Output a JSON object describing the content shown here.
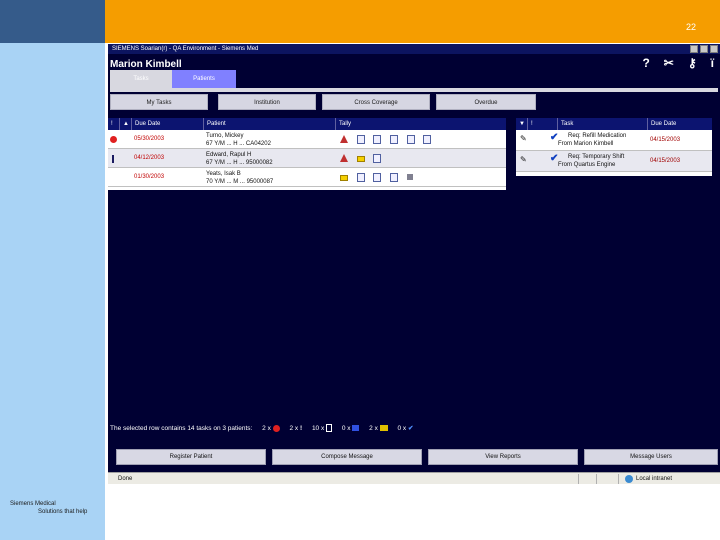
{
  "slide": {
    "number": "22",
    "footer_line1": "Siemens Medical",
    "footer_line2": "Solutions that help"
  },
  "window": {
    "title": "SIEMENS Soarian(r) - QA Environment - Siemens Med",
    "user_name": "Marion Kimbell"
  },
  "header_icons": [
    {
      "name": "help-icon",
      "glyph": "?"
    },
    {
      "name": "tools-icon",
      "glyph": "✂"
    },
    {
      "name": "key-icon",
      "glyph": "⚷"
    },
    {
      "name": "user-icon",
      "glyph": "ï"
    }
  ],
  "main_tabs": [
    {
      "label": "Tasks",
      "active": true
    },
    {
      "label": "Patients",
      "active": false
    }
  ],
  "sub_tabs": [
    {
      "label": "My Tasks"
    },
    {
      "label": "Institution"
    },
    {
      "label": "Cross Coverage"
    },
    {
      "label": "Overdue"
    }
  ],
  "left_table": {
    "headers": {
      "flag": "!",
      "due_date": "Due Date",
      "patient": "Patient",
      "tally": "Tally"
    },
    "rows": [
      {
        "flag": "red",
        "due_date": "05/30/2003",
        "patient_name": "Turno, Mickey",
        "patient_info": "67 Y/M  ...  H  ...  CA04202",
        "tally": [
          "alert",
          "doc",
          "doc",
          "doc",
          "doc",
          "doc",
          "doc"
        ]
      },
      {
        "flag": "bar",
        "due_date": "04/12/2003",
        "patient_name": "Edward, Rapul H",
        "patient_info": "67 Y/M  ...  H  ...  95000082",
        "tally": [
          "alert-doc",
          "env",
          "doc"
        ]
      },
      {
        "flag": "none",
        "due_date": "01/30/2003",
        "patient_name": "Yeats, Isak B",
        "patient_info": "70 Y/M  ...  M  ...  95000087",
        "tally": [
          "env",
          "doc",
          "doc",
          "doc",
          "mini"
        ]
      }
    ]
  },
  "right_table": {
    "headers": {
      "flag": "!",
      "task": "Task",
      "due_date": "Due Date"
    },
    "rows": [
      {
        "line1": "Req: Refill Medication",
        "line2": "From Marion Kimbell",
        "due_date": "04/15/2003"
      },
      {
        "line1": "Req: Temporary Shift",
        "line2": "From Quartus Engine",
        "due_date": "04/15/2003"
      }
    ]
  },
  "status_line": {
    "text": "The selected row contains 14 tasks on 3 patients:",
    "counts": [
      "2 x",
      "2 x",
      "10 x",
      "0 x",
      "2 x",
      "0 x"
    ]
  },
  "action_buttons": [
    {
      "label": "Register Patient"
    },
    {
      "label": "Compose Message"
    },
    {
      "label": "View Reports"
    },
    {
      "label": "Message Users"
    }
  ],
  "browser_status": {
    "left": "Done",
    "zone": "Local intranet"
  }
}
